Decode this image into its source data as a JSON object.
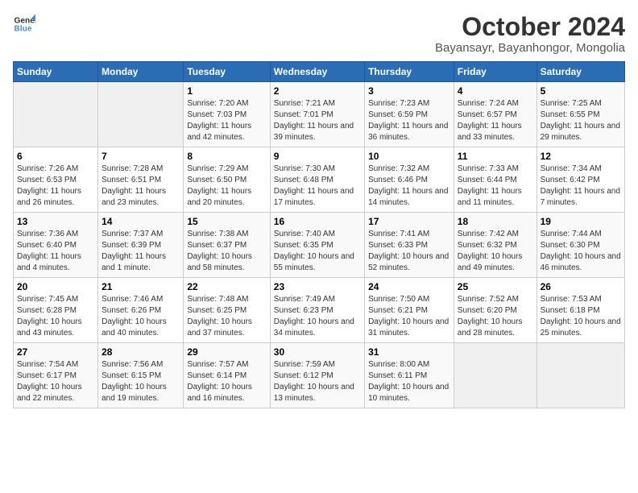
{
  "logo": {
    "line1": "General",
    "line2": "Blue"
  },
  "title": "October 2024",
  "subtitle": "Bayansayr, Bayanhongor, Mongolia",
  "days_of_week": [
    "Sunday",
    "Monday",
    "Tuesday",
    "Wednesday",
    "Thursday",
    "Friday",
    "Saturday"
  ],
  "weeks": [
    [
      {
        "num": "",
        "info": ""
      },
      {
        "num": "",
        "info": ""
      },
      {
        "num": "1",
        "info": "Sunrise: 7:20 AM\nSunset: 7:03 PM\nDaylight: 11 hours and 42 minutes."
      },
      {
        "num": "2",
        "info": "Sunrise: 7:21 AM\nSunset: 7:01 PM\nDaylight: 11 hours and 39 minutes."
      },
      {
        "num": "3",
        "info": "Sunrise: 7:23 AM\nSunset: 6:59 PM\nDaylight: 11 hours and 36 minutes."
      },
      {
        "num": "4",
        "info": "Sunrise: 7:24 AM\nSunset: 6:57 PM\nDaylight: 11 hours and 33 minutes."
      },
      {
        "num": "5",
        "info": "Sunrise: 7:25 AM\nSunset: 6:55 PM\nDaylight: 11 hours and 29 minutes."
      }
    ],
    [
      {
        "num": "6",
        "info": "Sunrise: 7:26 AM\nSunset: 6:53 PM\nDaylight: 11 hours and 26 minutes."
      },
      {
        "num": "7",
        "info": "Sunrise: 7:28 AM\nSunset: 6:51 PM\nDaylight: 11 hours and 23 minutes."
      },
      {
        "num": "8",
        "info": "Sunrise: 7:29 AM\nSunset: 6:50 PM\nDaylight: 11 hours and 20 minutes."
      },
      {
        "num": "9",
        "info": "Sunrise: 7:30 AM\nSunset: 6:48 PM\nDaylight: 11 hours and 17 minutes."
      },
      {
        "num": "10",
        "info": "Sunrise: 7:32 AM\nSunset: 6:46 PM\nDaylight: 11 hours and 14 minutes."
      },
      {
        "num": "11",
        "info": "Sunrise: 7:33 AM\nSunset: 6:44 PM\nDaylight: 11 hours and 11 minutes."
      },
      {
        "num": "12",
        "info": "Sunrise: 7:34 AM\nSunset: 6:42 PM\nDaylight: 11 hours and 7 minutes."
      }
    ],
    [
      {
        "num": "13",
        "info": "Sunrise: 7:36 AM\nSunset: 6:40 PM\nDaylight: 11 hours and 4 minutes."
      },
      {
        "num": "14",
        "info": "Sunrise: 7:37 AM\nSunset: 6:39 PM\nDaylight: 11 hours and 1 minute."
      },
      {
        "num": "15",
        "info": "Sunrise: 7:38 AM\nSunset: 6:37 PM\nDaylight: 10 hours and 58 minutes."
      },
      {
        "num": "16",
        "info": "Sunrise: 7:40 AM\nSunset: 6:35 PM\nDaylight: 10 hours and 55 minutes."
      },
      {
        "num": "17",
        "info": "Sunrise: 7:41 AM\nSunset: 6:33 PM\nDaylight: 10 hours and 52 minutes."
      },
      {
        "num": "18",
        "info": "Sunrise: 7:42 AM\nSunset: 6:32 PM\nDaylight: 10 hours and 49 minutes."
      },
      {
        "num": "19",
        "info": "Sunrise: 7:44 AM\nSunset: 6:30 PM\nDaylight: 10 hours and 46 minutes."
      }
    ],
    [
      {
        "num": "20",
        "info": "Sunrise: 7:45 AM\nSunset: 6:28 PM\nDaylight: 10 hours and 43 minutes."
      },
      {
        "num": "21",
        "info": "Sunrise: 7:46 AM\nSunset: 6:26 PM\nDaylight: 10 hours and 40 minutes."
      },
      {
        "num": "22",
        "info": "Sunrise: 7:48 AM\nSunset: 6:25 PM\nDaylight: 10 hours and 37 minutes."
      },
      {
        "num": "23",
        "info": "Sunrise: 7:49 AM\nSunset: 6:23 PM\nDaylight: 10 hours and 34 minutes."
      },
      {
        "num": "24",
        "info": "Sunrise: 7:50 AM\nSunset: 6:21 PM\nDaylight: 10 hours and 31 minutes."
      },
      {
        "num": "25",
        "info": "Sunrise: 7:52 AM\nSunset: 6:20 PM\nDaylight: 10 hours and 28 minutes."
      },
      {
        "num": "26",
        "info": "Sunrise: 7:53 AM\nSunset: 6:18 PM\nDaylight: 10 hours and 25 minutes."
      }
    ],
    [
      {
        "num": "27",
        "info": "Sunrise: 7:54 AM\nSunset: 6:17 PM\nDaylight: 10 hours and 22 minutes."
      },
      {
        "num": "28",
        "info": "Sunrise: 7:56 AM\nSunset: 6:15 PM\nDaylight: 10 hours and 19 minutes."
      },
      {
        "num": "29",
        "info": "Sunrise: 7:57 AM\nSunset: 6:14 PM\nDaylight: 10 hours and 16 minutes."
      },
      {
        "num": "30",
        "info": "Sunrise: 7:59 AM\nSunset: 6:12 PM\nDaylight: 10 hours and 13 minutes."
      },
      {
        "num": "31",
        "info": "Sunrise: 8:00 AM\nSunset: 6:11 PM\nDaylight: 10 hours and 10 minutes."
      },
      {
        "num": "",
        "info": ""
      },
      {
        "num": "",
        "info": ""
      }
    ]
  ]
}
